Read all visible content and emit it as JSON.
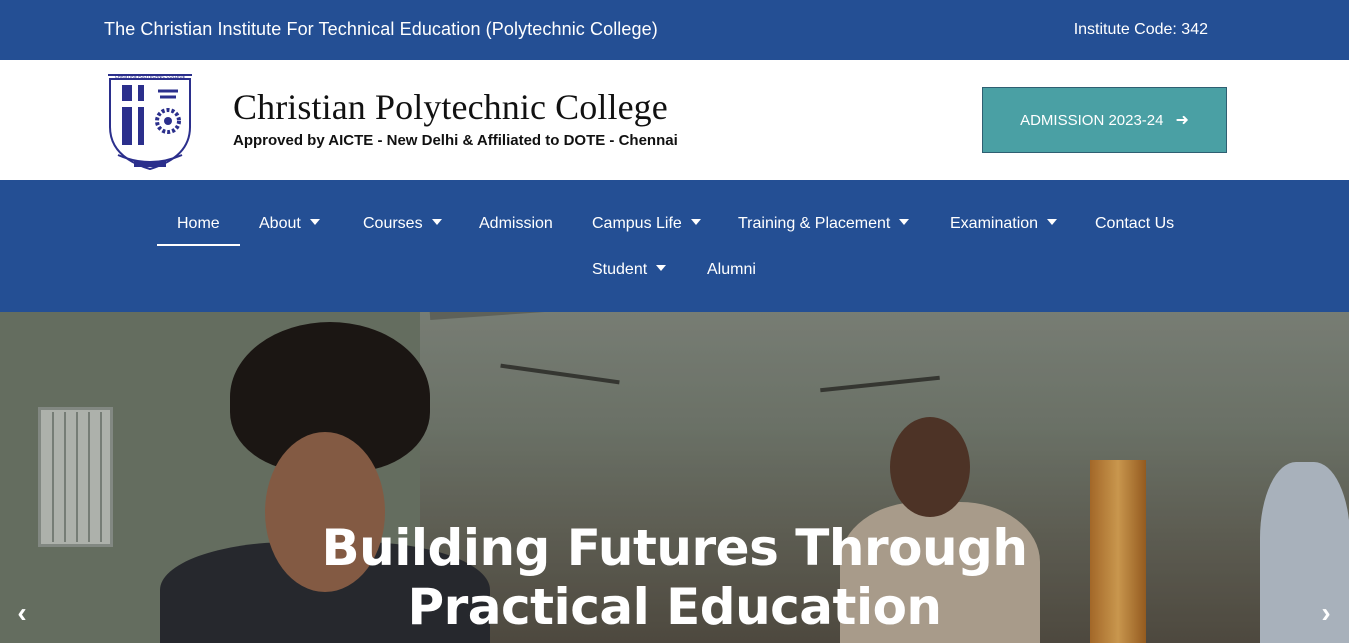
{
  "topbar": {
    "institute_name": "The Christian Institute For Technical Education (Polytechnic College)",
    "institute_code": "Institute Code: 342",
    "background_color": "#244f94"
  },
  "header": {
    "college_name": "Christian Polytechnic College",
    "approval": "Approved by AICTE - New Delhi & Affiliated to DOTE - Chennai",
    "admission_button": "ADMISSION 2023-24",
    "admission_button_icon": "arrow-right-icon",
    "admission_button_color": "#4aa0a4",
    "logo_icon": "college-crest-logo"
  },
  "nav": {
    "background_color": "#244f94",
    "items": [
      {
        "label": "Home",
        "active": true,
        "dropdown": false
      },
      {
        "label": "About",
        "dropdown": true
      },
      {
        "label": "Courses",
        "dropdown": true
      },
      {
        "label": "Admission",
        "dropdown": false
      },
      {
        "label": "Campus Life",
        "dropdown": true
      },
      {
        "label": "Training & Placement",
        "dropdown": true
      },
      {
        "label": "Examination",
        "dropdown": true
      },
      {
        "label": "Contact Us",
        "dropdown": false
      },
      {
        "label": "Student",
        "dropdown": true
      },
      {
        "label": "Alumni",
        "dropdown": false
      }
    ]
  },
  "hero": {
    "heading_line1": "Building Futures Through",
    "heading_line2": "Practical Education",
    "prev_icon": "chevron-left-icon",
    "next_icon": "chevron-right-icon"
  }
}
